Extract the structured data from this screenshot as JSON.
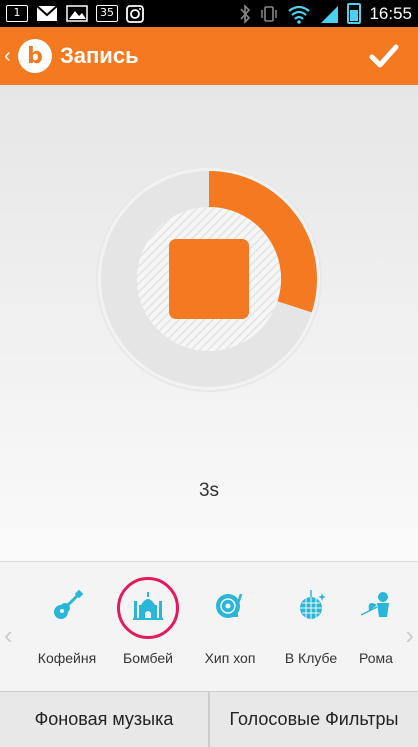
{
  "status": {
    "notification_count": "1",
    "temperature": "35",
    "time": "16:55"
  },
  "header": {
    "title": "Запись",
    "logo_letter": "b"
  },
  "recording": {
    "elapsed": "3s",
    "progress": 0.3,
    "accent_color": "#f47920"
  },
  "presets": {
    "items": [
      {
        "label": "Кофейня",
        "icon": "guitar-icon"
      },
      {
        "label": "Бомбей",
        "icon": "temple-icon"
      },
      {
        "label": "Хип хоп",
        "icon": "turntable-icon"
      },
      {
        "label": "В Клубе",
        "icon": "disco-ball-icon"
      },
      {
        "label": "Рома",
        "icon": "cupid-icon"
      }
    ],
    "selected": "Бомбей",
    "selected_color": "#e21c5a",
    "icon_color": "#29b6d8"
  },
  "footer": {
    "background_music": "Фоновая музыка",
    "voice_filters": "Голосовые Фильтры"
  }
}
